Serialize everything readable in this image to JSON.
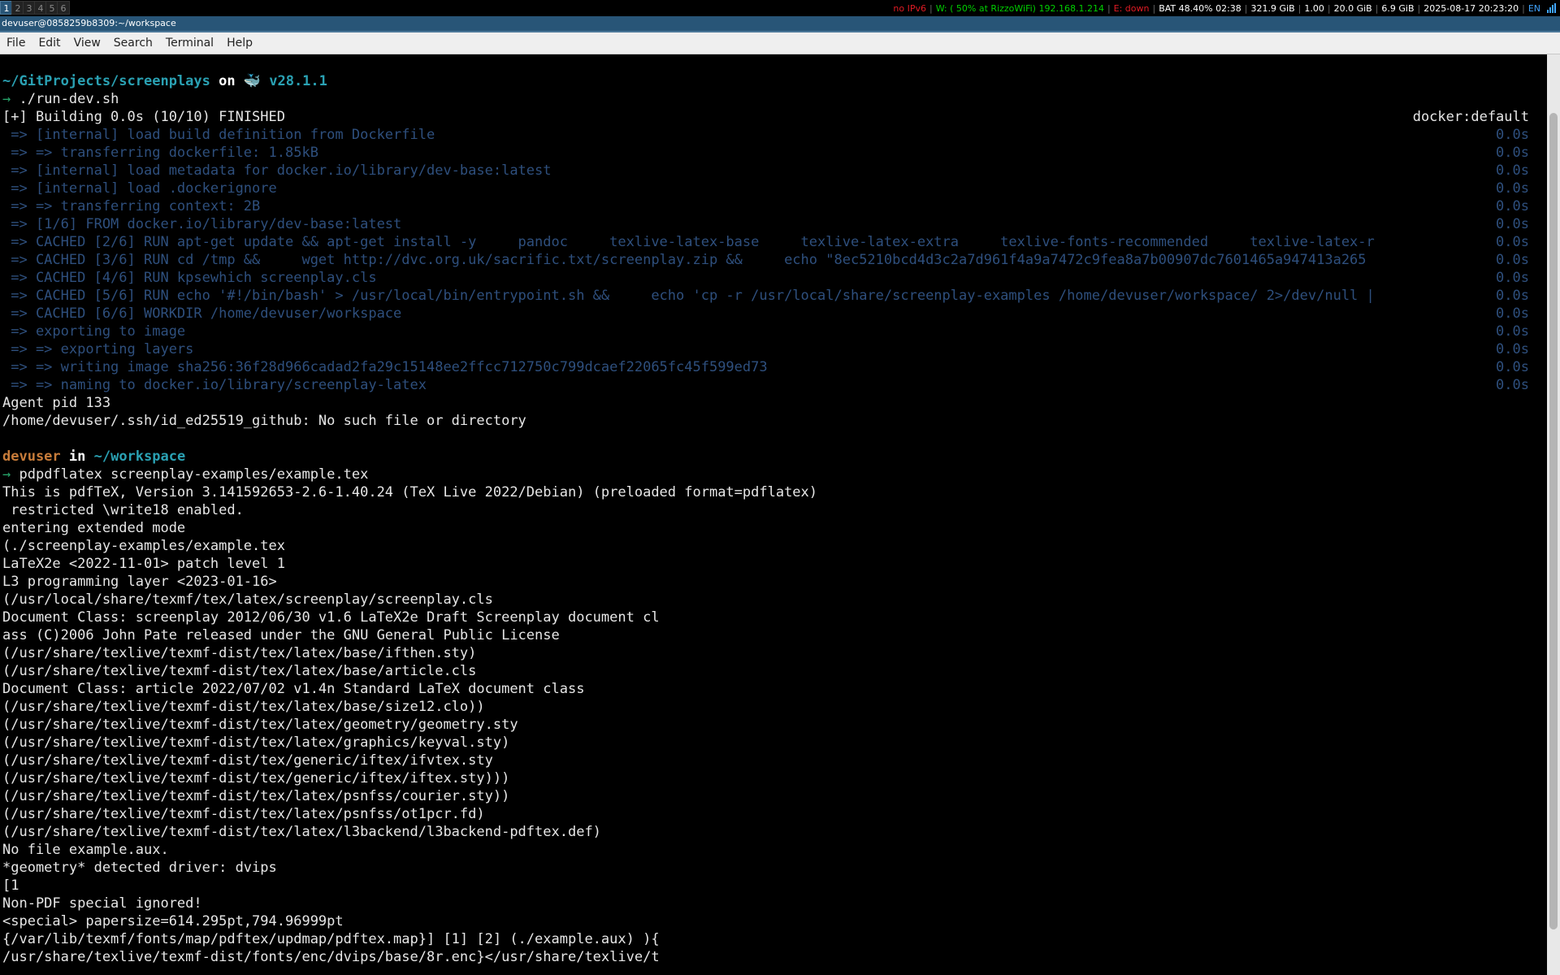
{
  "bar": {
    "workspaces": [
      "1",
      "2",
      "3",
      "4",
      "5",
      "6"
    ],
    "active_workspace": "1",
    "status": {
      "ipv6": "no IPv6",
      "wifi": "W: ( 50% at RizzoWiFi) 192.168.1.214",
      "eth": "E: down",
      "battery": "BAT 48.40% 02:38",
      "disk": "321.9 GiB",
      "load": "1.00",
      "mem_used": "20.0 GiB",
      "mem_free": "6.9 GiB",
      "datetime": "2025-08-17 20:23:20",
      "lang": "EN"
    },
    "colors": {
      "active_ws": "#285577",
      "red": "#e01b24",
      "green": "#00d000",
      "blue": "#3fa4ff"
    }
  },
  "window": {
    "title": "devuser@0858259b8309:~/workspace"
  },
  "menu": [
    "File",
    "Edit",
    "View",
    "Search",
    "Terminal",
    "Help"
  ],
  "terminal": {
    "prompt1": {
      "path": "~/GitProjects/screenplays",
      "on": " on ",
      "whale": "🐳",
      "version": " v28.1.1"
    },
    "arrow": "→",
    "cmd1": " ./run-dev.sh",
    "build_header": "[+] Building 0.0s (10/10) FINISHED",
    "build_context": "docker:default",
    "build_steps": [
      {
        "text": " => [internal] load build definition from Dockerfile",
        "time": "0.0s"
      },
      {
        "text": " => => transferring dockerfile: 1.85kB",
        "time": "0.0s"
      },
      {
        "text": " => [internal] load metadata for docker.io/library/dev-base:latest",
        "time": "0.0s"
      },
      {
        "text": " => [internal] load .dockerignore",
        "time": "0.0s"
      },
      {
        "text": " => => transferring context: 2B",
        "time": "0.0s"
      },
      {
        "text": " => [1/6] FROM docker.io/library/dev-base:latest",
        "time": "0.0s"
      },
      {
        "text": " => CACHED [2/6] RUN apt-get update && apt-get install -y     pandoc     texlive-latex-base     texlive-latex-extra     texlive-fonts-recommended     texlive-latex-r",
        "time": "0.0s"
      },
      {
        "text": " => CACHED [3/6] RUN cd /tmp &&     wget http://dvc.org.uk/sacrific.txt/screenplay.zip &&     echo \"8ec5210bcd4d3c2a7d961f4a9a7472c9fea8a7b00907dc7601465a947413a265",
        "time": "0.0s"
      },
      {
        "text": " => CACHED [4/6] RUN kpsewhich screenplay.cls",
        "time": "0.0s"
      },
      {
        "text": " => CACHED [5/6] RUN echo '#!/bin/bash' > /usr/local/bin/entrypoint.sh &&     echo 'cp -r /usr/local/share/screenplay-examples /home/devuser/workspace/ 2>/dev/null |",
        "time": "0.0s"
      },
      {
        "text": " => CACHED [6/6] WORKDIR /home/devuser/workspace",
        "time": "0.0s"
      },
      {
        "text": " => exporting to image",
        "time": "0.0s"
      },
      {
        "text": " => => exporting layers",
        "time": "0.0s"
      },
      {
        "text": " => => writing image sha256:36f28d966cadad2fa29c15148ee2ffcc712750c799dcaef22065fc45f599ed73",
        "time": "0.0s"
      },
      {
        "text": " => => naming to docker.io/library/screenplay-latex",
        "time": "0.0s"
      }
    ],
    "agent_lines": [
      "Agent pid 133",
      "/home/devuser/.ssh/id_ed25519_github: No such file or directory"
    ],
    "prompt2": {
      "user": "devuser",
      "in": " in ",
      "path": "~/workspace"
    },
    "cmd2": " pdpdflatex screenplay-examples/example.tex",
    "output": [
      "This is pdfTeX, Version 3.141592653-2.6-1.40.24 (TeX Live 2022/Debian) (preloaded format=pdflatex)",
      " restricted \\write18 enabled.",
      "entering extended mode",
      "(./screenplay-examples/example.tex",
      "LaTeX2e <2022-11-01> patch level 1",
      "L3 programming layer <2023-01-16>",
      "(/usr/local/share/texmf/tex/latex/screenplay/screenplay.cls",
      "Document Class: screenplay 2012/06/30 v1.6 LaTeX2e Draft Screenplay document cl",
      "ass (C)2006 John Pate released under the GNU General Public License",
      "(/usr/share/texlive/texmf-dist/tex/latex/base/ifthen.sty)",
      "(/usr/share/texlive/texmf-dist/tex/latex/base/article.cls",
      "Document Class: article 2022/07/02 v1.4n Standard LaTeX document class",
      "(/usr/share/texlive/texmf-dist/tex/latex/base/size12.clo))",
      "(/usr/share/texlive/texmf-dist/tex/latex/geometry/geometry.sty",
      "(/usr/share/texlive/texmf-dist/tex/latex/graphics/keyval.sty)",
      "(/usr/share/texlive/texmf-dist/tex/generic/iftex/ifvtex.sty",
      "(/usr/share/texlive/texmf-dist/tex/generic/iftex/iftex.sty)))",
      "(/usr/share/texlive/texmf-dist/tex/latex/psnfss/courier.sty))",
      "(/usr/share/texlive/texmf-dist/tex/latex/psnfss/ot1pcr.fd)",
      "(/usr/share/texlive/texmf-dist/tex/latex/l3backend/l3backend-pdftex.def)",
      "No file example.aux.",
      "*geometry* detected driver: dvips",
      "[1",
      "Non-PDF special ignored!",
      "<special> papersize=614.295pt,794.96999pt",
      "{/var/lib/texmf/fonts/map/pdftex/updmap/pdftex.map}] [1] [2] (./example.aux) ){",
      "/usr/share/texlive/texmf-dist/fonts/enc/dvips/base/8r.enc}</usr/share/texlive/t"
    ]
  }
}
